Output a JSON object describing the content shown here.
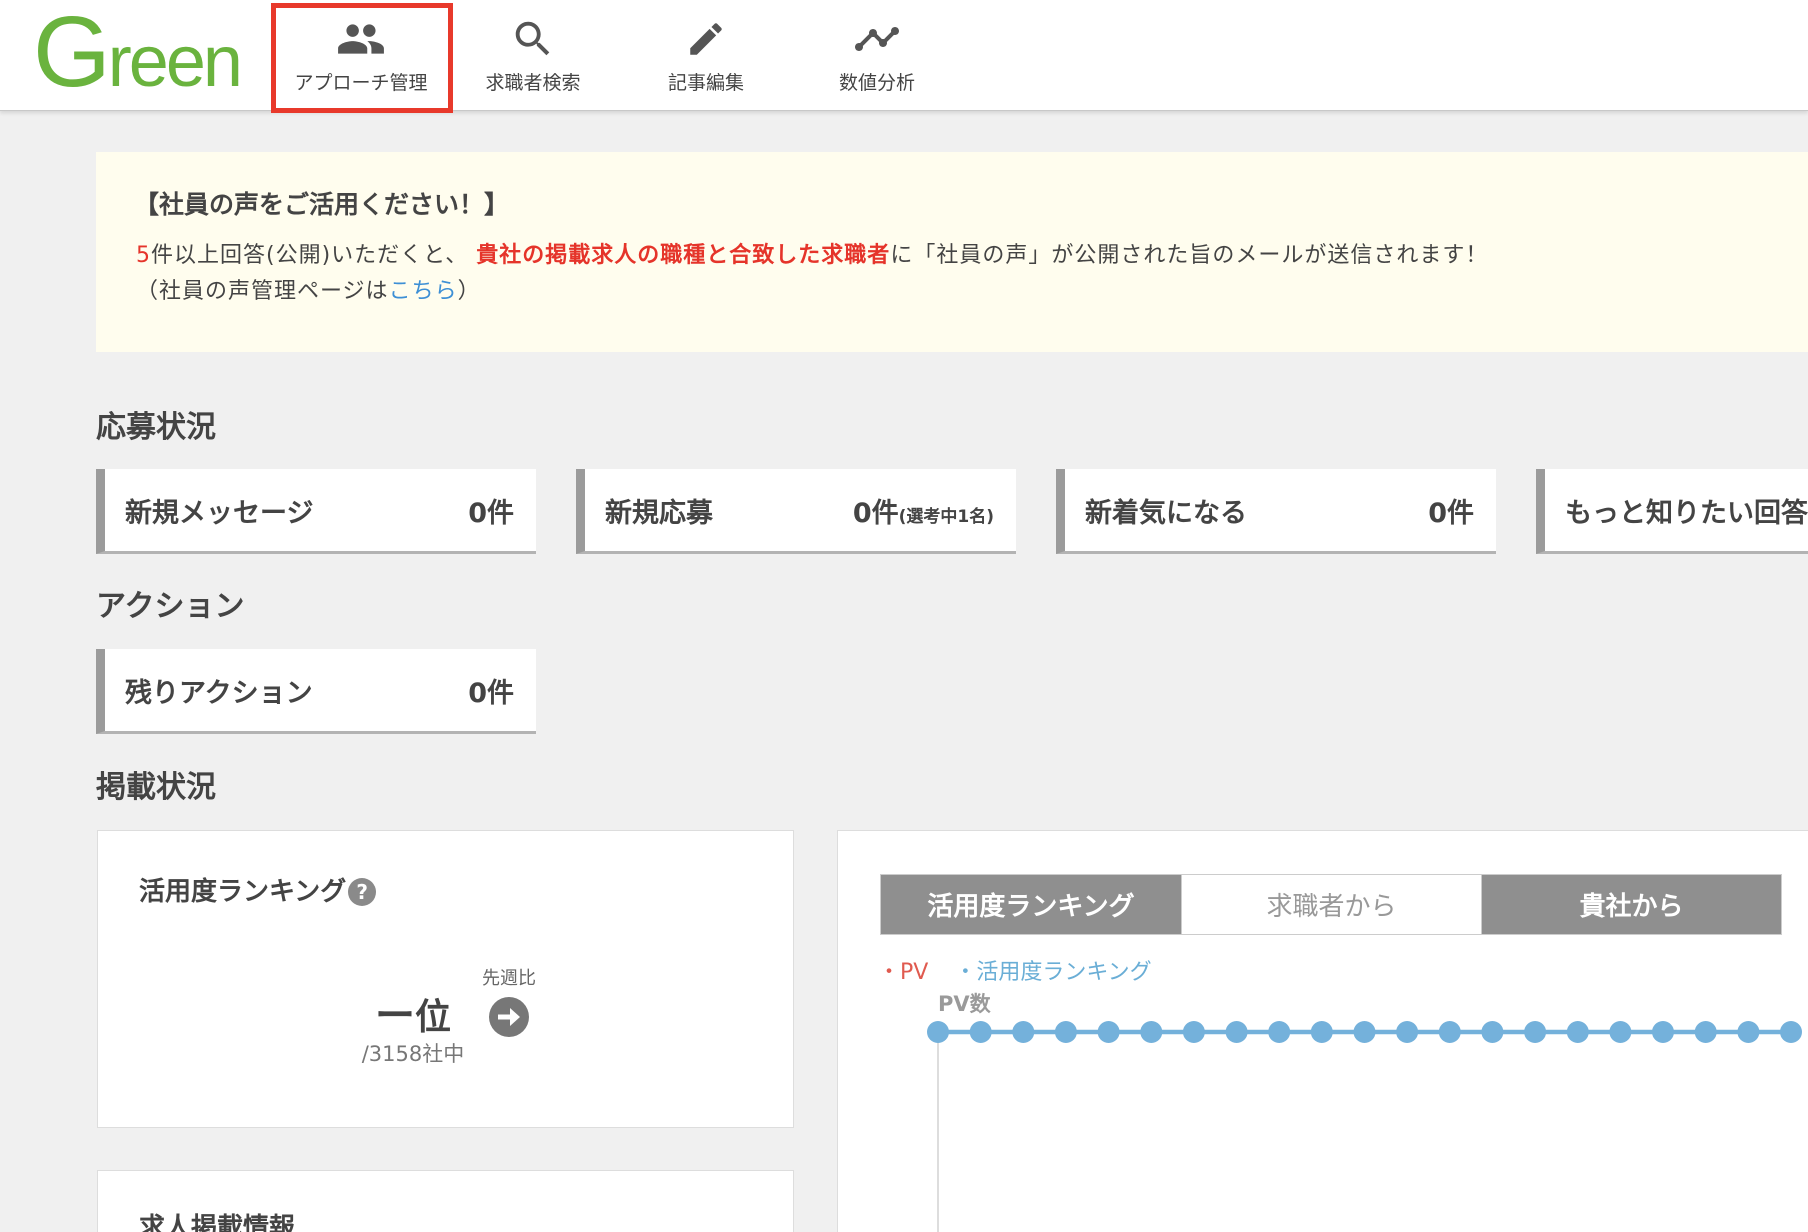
{
  "logo": {
    "text": "Green"
  },
  "nav": [
    {
      "label": "アプローチ管理",
      "icon": "people-icon"
    },
    {
      "label": "求職者検索",
      "icon": "search-icon"
    },
    {
      "label": "記事編集",
      "icon": "pencil-icon"
    },
    {
      "label": "数値分析",
      "icon": "line-chart-icon"
    }
  ],
  "banner": {
    "title": "【社員の声をご活用ください！】",
    "line1_count": "5",
    "line1_a": "件以上回答(公開)いただくと、",
    "line1_highlight": "貴社の掲載求人の職種と合致した求職者",
    "line1_b": "に「社員の声」が公開された旨のメールが送信されます！",
    "line2_a": "（社員の声管理ページは",
    "line2_link": "こちら",
    "line2_b": "）"
  },
  "sections": {
    "applications": "応募状況",
    "actions": "アクション",
    "listings": "掲載状況"
  },
  "application_cards": [
    {
      "label": "新規メッセージ",
      "value": "0件"
    },
    {
      "label": "新規応募",
      "value": "0件",
      "note": "(選考中1名)"
    },
    {
      "label": "新着気になる",
      "value": "0件"
    },
    {
      "label": "もっと知りたい回答"
    }
  ],
  "action_cards": [
    {
      "label": "残りアクション",
      "value": "0件"
    }
  ],
  "ranking_panel": {
    "title": "活用度ランキング",
    "help": "?",
    "compare_label": "先週比",
    "rank": "ー",
    "rank_unit": "位",
    "total": "/3158社中"
  },
  "listing_panel": {
    "title": "求人掲載情報"
  },
  "chart_panel": {
    "tabs": [
      {
        "label": "活用度ランキング",
        "selected": false
      },
      {
        "label": "求職者から",
        "selected": true
      },
      {
        "label": "貴社から",
        "selected": false
      }
    ],
    "legend": [
      "・PV",
      "・活用度ランキング"
    ],
    "y_label": "PV数"
  },
  "colors": {
    "brand_green": "#6ab33e",
    "highlight": "#e8392b",
    "alert_red": "#e5342a",
    "link_blue": "#3d8fd5",
    "pv_series": "#e05a4f",
    "ranking_series": "#74b1db"
  }
}
